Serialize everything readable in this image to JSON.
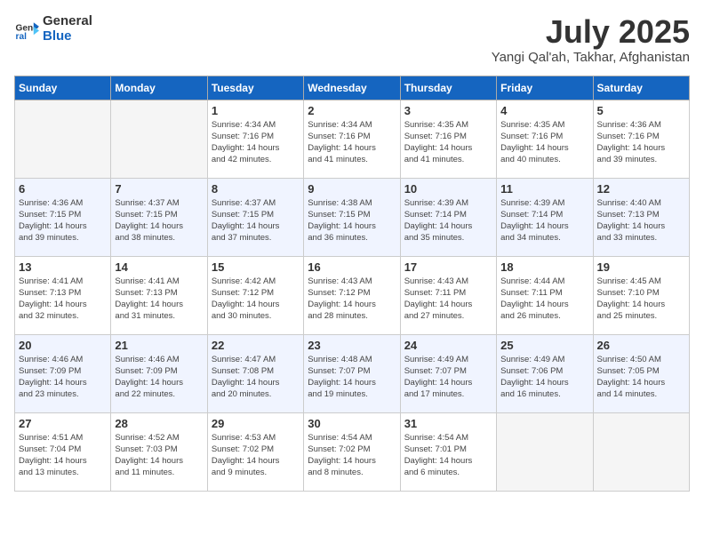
{
  "logo": {
    "line1": "General",
    "line2": "Blue"
  },
  "title": "July 2025",
  "subtitle": "Yangi Qal'ah, Takhar, Afghanistan",
  "days_header": [
    "Sunday",
    "Monday",
    "Tuesday",
    "Wednesday",
    "Thursday",
    "Friday",
    "Saturday"
  ],
  "weeks": [
    [
      {
        "day": "",
        "info": ""
      },
      {
        "day": "",
        "info": ""
      },
      {
        "day": "1",
        "info": "Sunrise: 4:34 AM\nSunset: 7:16 PM\nDaylight: 14 hours\nand 42 minutes."
      },
      {
        "day": "2",
        "info": "Sunrise: 4:34 AM\nSunset: 7:16 PM\nDaylight: 14 hours\nand 41 minutes."
      },
      {
        "day": "3",
        "info": "Sunrise: 4:35 AM\nSunset: 7:16 PM\nDaylight: 14 hours\nand 41 minutes."
      },
      {
        "day": "4",
        "info": "Sunrise: 4:35 AM\nSunset: 7:16 PM\nDaylight: 14 hours\nand 40 minutes."
      },
      {
        "day": "5",
        "info": "Sunrise: 4:36 AM\nSunset: 7:16 PM\nDaylight: 14 hours\nand 39 minutes."
      }
    ],
    [
      {
        "day": "6",
        "info": "Sunrise: 4:36 AM\nSunset: 7:15 PM\nDaylight: 14 hours\nand 39 minutes."
      },
      {
        "day": "7",
        "info": "Sunrise: 4:37 AM\nSunset: 7:15 PM\nDaylight: 14 hours\nand 38 minutes."
      },
      {
        "day": "8",
        "info": "Sunrise: 4:37 AM\nSunset: 7:15 PM\nDaylight: 14 hours\nand 37 minutes."
      },
      {
        "day": "9",
        "info": "Sunrise: 4:38 AM\nSunset: 7:15 PM\nDaylight: 14 hours\nand 36 minutes."
      },
      {
        "day": "10",
        "info": "Sunrise: 4:39 AM\nSunset: 7:14 PM\nDaylight: 14 hours\nand 35 minutes."
      },
      {
        "day": "11",
        "info": "Sunrise: 4:39 AM\nSunset: 7:14 PM\nDaylight: 14 hours\nand 34 minutes."
      },
      {
        "day": "12",
        "info": "Sunrise: 4:40 AM\nSunset: 7:13 PM\nDaylight: 14 hours\nand 33 minutes."
      }
    ],
    [
      {
        "day": "13",
        "info": "Sunrise: 4:41 AM\nSunset: 7:13 PM\nDaylight: 14 hours\nand 32 minutes."
      },
      {
        "day": "14",
        "info": "Sunrise: 4:41 AM\nSunset: 7:13 PM\nDaylight: 14 hours\nand 31 minutes."
      },
      {
        "day": "15",
        "info": "Sunrise: 4:42 AM\nSunset: 7:12 PM\nDaylight: 14 hours\nand 30 minutes."
      },
      {
        "day": "16",
        "info": "Sunrise: 4:43 AM\nSunset: 7:12 PM\nDaylight: 14 hours\nand 28 minutes."
      },
      {
        "day": "17",
        "info": "Sunrise: 4:43 AM\nSunset: 7:11 PM\nDaylight: 14 hours\nand 27 minutes."
      },
      {
        "day": "18",
        "info": "Sunrise: 4:44 AM\nSunset: 7:11 PM\nDaylight: 14 hours\nand 26 minutes."
      },
      {
        "day": "19",
        "info": "Sunrise: 4:45 AM\nSunset: 7:10 PM\nDaylight: 14 hours\nand 25 minutes."
      }
    ],
    [
      {
        "day": "20",
        "info": "Sunrise: 4:46 AM\nSunset: 7:09 PM\nDaylight: 14 hours\nand 23 minutes."
      },
      {
        "day": "21",
        "info": "Sunrise: 4:46 AM\nSunset: 7:09 PM\nDaylight: 14 hours\nand 22 minutes."
      },
      {
        "day": "22",
        "info": "Sunrise: 4:47 AM\nSunset: 7:08 PM\nDaylight: 14 hours\nand 20 minutes."
      },
      {
        "day": "23",
        "info": "Sunrise: 4:48 AM\nSunset: 7:07 PM\nDaylight: 14 hours\nand 19 minutes."
      },
      {
        "day": "24",
        "info": "Sunrise: 4:49 AM\nSunset: 7:07 PM\nDaylight: 14 hours\nand 17 minutes."
      },
      {
        "day": "25",
        "info": "Sunrise: 4:49 AM\nSunset: 7:06 PM\nDaylight: 14 hours\nand 16 minutes."
      },
      {
        "day": "26",
        "info": "Sunrise: 4:50 AM\nSunset: 7:05 PM\nDaylight: 14 hours\nand 14 minutes."
      }
    ],
    [
      {
        "day": "27",
        "info": "Sunrise: 4:51 AM\nSunset: 7:04 PM\nDaylight: 14 hours\nand 13 minutes."
      },
      {
        "day": "28",
        "info": "Sunrise: 4:52 AM\nSunset: 7:03 PM\nDaylight: 14 hours\nand 11 minutes."
      },
      {
        "day": "29",
        "info": "Sunrise: 4:53 AM\nSunset: 7:02 PM\nDaylight: 14 hours\nand 9 minutes."
      },
      {
        "day": "30",
        "info": "Sunrise: 4:54 AM\nSunset: 7:02 PM\nDaylight: 14 hours\nand 8 minutes."
      },
      {
        "day": "31",
        "info": "Sunrise: 4:54 AM\nSunset: 7:01 PM\nDaylight: 14 hours\nand 6 minutes."
      },
      {
        "day": "",
        "info": ""
      },
      {
        "day": "",
        "info": ""
      }
    ]
  ]
}
